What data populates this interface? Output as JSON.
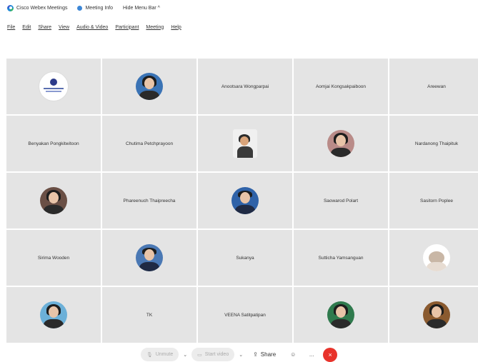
{
  "titlebar": {
    "app": "Cisco Webex Meetings",
    "meeting_info": "Meeting Info",
    "hide_menu": "Hide Menu Bar ^"
  },
  "menu": [
    "File",
    "Edit",
    "Share",
    "View",
    "Audio & Video",
    "Participant",
    "Meeting",
    "Help"
  ],
  "participants": [
    {
      "name": "",
      "kind": "logo-icon"
    },
    {
      "name": "",
      "kind": "photo-woman",
      "bg": "#3a73b5"
    },
    {
      "name": "Anootsara Wongparpai",
      "kind": "text"
    },
    {
      "name": "Aomjai Kongsakpaiboon",
      "kind": "text"
    },
    {
      "name": "Areewan",
      "kind": "text"
    },
    {
      "name": "Benyakan Pongkitwitoon",
      "kind": "text"
    },
    {
      "name": "Chutima Petchprayoon",
      "kind": "text"
    },
    {
      "name": "",
      "kind": "photo-rect"
    },
    {
      "name": "",
      "kind": "photo-woman",
      "bg": "#b98b88"
    },
    {
      "name": "Nardanong Thaipituk",
      "kind": "text"
    },
    {
      "name": "",
      "kind": "photo-woman",
      "bg": "#6a4f45"
    },
    {
      "name": "Phareenuch Thaipreecha",
      "kind": "text"
    },
    {
      "name": "",
      "kind": "photo-man",
      "bg": "#2f62a8"
    },
    {
      "name": "Saowarod Polart",
      "kind": "text"
    },
    {
      "name": "Sasitorn Poplee",
      "kind": "text"
    },
    {
      "name": "Sirima Wooden",
      "kind": "text"
    },
    {
      "name": "",
      "kind": "photo-man",
      "bg": "#4a78b4"
    },
    {
      "name": "Sukanya",
      "kind": "text"
    },
    {
      "name": "Sutticha Yamsanguan",
      "kind": "text"
    },
    {
      "name": "",
      "kind": "photo-cat",
      "bg": "#ffffff"
    },
    {
      "name": "",
      "kind": "photo-woman",
      "bg": "#6cb0d8"
    },
    {
      "name": "TK",
      "kind": "text"
    },
    {
      "name": "VEENA Satitpatipan",
      "kind": "text"
    },
    {
      "name": "",
      "kind": "photo-woman",
      "bg": "#2f7a4d"
    },
    {
      "name": "",
      "kind": "photo-woman",
      "bg": "#8a5a2f"
    }
  ],
  "toolbar": {
    "unmute": "Unmute",
    "start_video": "Start video",
    "share": "Share",
    "reactions_icon": "reactions-icon",
    "more": "...",
    "end": "×"
  }
}
